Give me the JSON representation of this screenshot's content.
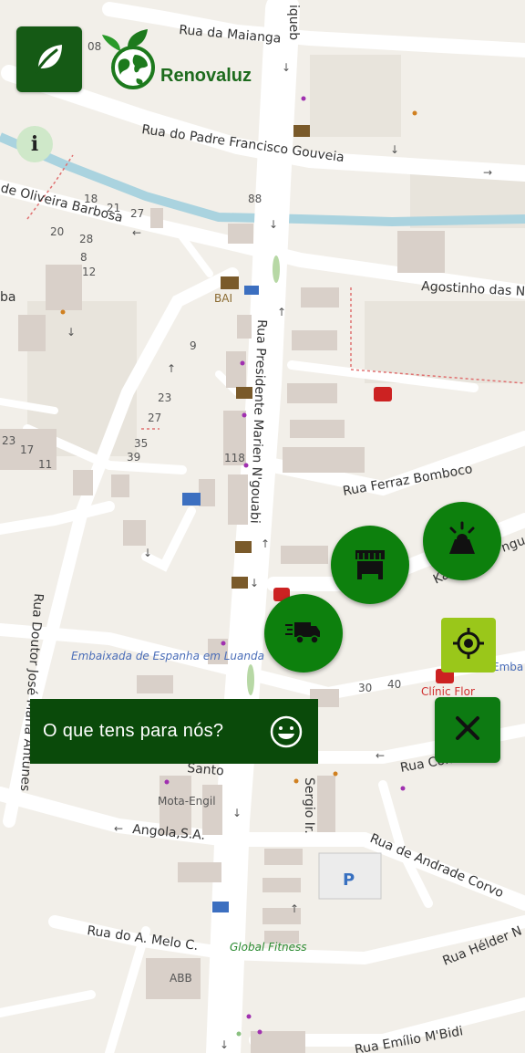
{
  "app": {
    "brand_name": "Renovaluz",
    "info_label": "i",
    "prompt_text": "O que tens para nós?",
    "colors": {
      "primary_green": "#0d800d",
      "dark_green": "#0a4a0a",
      "logo_green": "#155a15",
      "locate_green": "#9ac71a"
    },
    "icons": {
      "logo": "leaf-icon",
      "market": "market-stall-icon",
      "hazard": "warning-light-icon",
      "truck": "delivery-truck-icon",
      "locate": "crosshair-icon",
      "close": "close-icon",
      "prompt": "smiley-icon"
    }
  },
  "map": {
    "streets": [
      "Rua da Maianga",
      "Rua do Padre Francisco Gouveia",
      "de Oliveira Barbosa",
      "Agostinho das N",
      "Rua Presidente Marien N'gouabi",
      "Rua Ferraz Bomboco",
      "Rua Doutor José Maria Antunes",
      "Rua Com",
      "Rua de Andrade Corvo",
      "Angola,S.A.",
      "Rua do A. Melo C.",
      "Rua Hélder N",
      "Rua Emílio M'Bidi",
      "Sergio Ir.",
      "Santo",
      "Ka",
      "ba",
      "ngue"
    ],
    "pois": [
      "BAI",
      "Embaixada de Espanha em Luanda",
      "Mota-Engil",
      "Global Fitness",
      "ABB",
      "Clínic Flor",
      "Emba da Ín em Lua",
      "iqueb"
    ],
    "house_numbers": [
      "08",
      "18",
      "21",
      "27",
      "20",
      "28",
      "8",
      "12",
      "88",
      "9",
      "23",
      "27",
      "35",
      "39",
      "118",
      "23",
      "17",
      "11",
      "30",
      "40"
    ]
  }
}
